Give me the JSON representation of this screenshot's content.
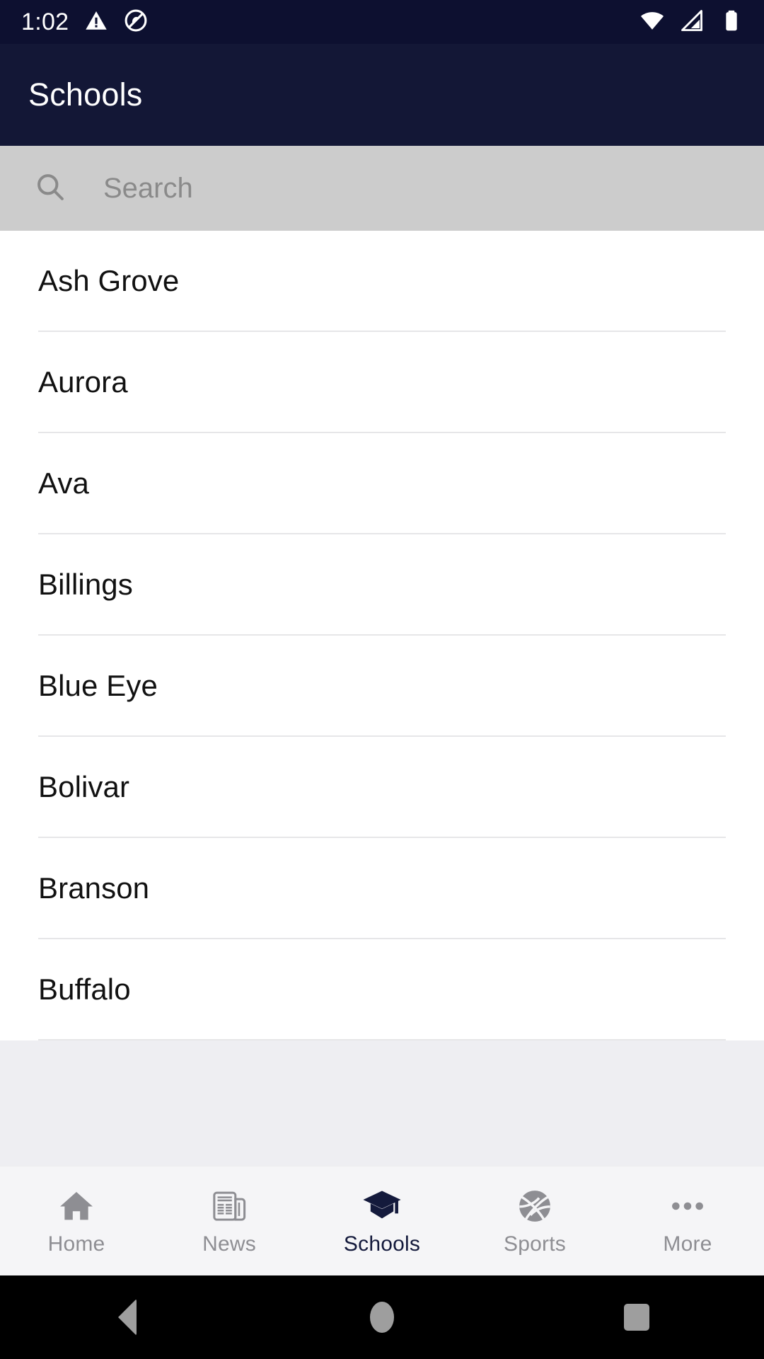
{
  "status_bar": {
    "clock": "1:02",
    "icons_left": [
      "warning-triangle-icon",
      "do-not-disturb-icon"
    ],
    "icons_right": [
      "wifi-icon",
      "cellular-signal-icon",
      "battery-icon"
    ]
  },
  "app_bar": {
    "title": "Schools",
    "background": "#131736"
  },
  "search": {
    "placeholder": "Search",
    "value": "",
    "icon": "search-icon",
    "background": "#cccccc"
  },
  "schools": [
    {
      "name": "Ash Grove"
    },
    {
      "name": "Aurora"
    },
    {
      "name": "Ava"
    },
    {
      "name": "Billings"
    },
    {
      "name": "Blue Eye"
    },
    {
      "name": "Bolivar"
    },
    {
      "name": "Branson"
    },
    {
      "name": "Buffalo"
    }
  ],
  "bottom_nav": {
    "active_index": 2,
    "active_color": "#141a3c",
    "inactive_color": "#8e8e93",
    "items": [
      {
        "label": "Home",
        "icon": "home-icon"
      },
      {
        "label": "News",
        "icon": "newspaper-icon"
      },
      {
        "label": "Schools",
        "icon": "graduation-cap-icon"
      },
      {
        "label": "Sports",
        "icon": "basketball-icon"
      },
      {
        "label": "More",
        "icon": "ellipsis-icon"
      }
    ]
  },
  "system_nav": {
    "back": "back-triangle-icon",
    "home": "home-circle-icon",
    "recents": "recents-square-icon"
  }
}
